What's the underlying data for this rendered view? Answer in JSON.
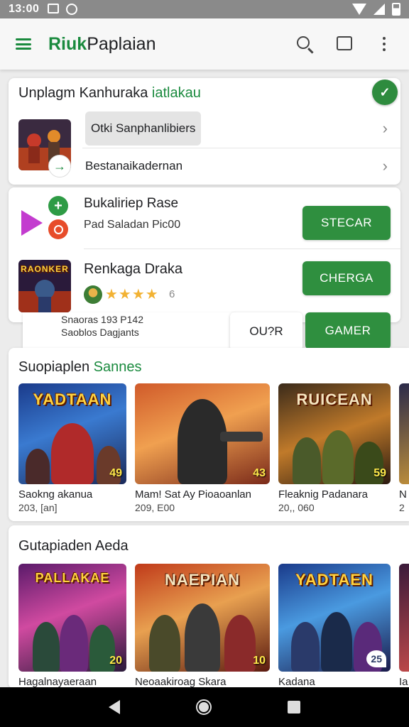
{
  "status_bar": {
    "time": "13:00"
  },
  "app_bar": {
    "title_part1": "Riuk",
    "title_part2": "Paplaian"
  },
  "card1": {
    "title_part1": "Unplagm Kanhuraka ",
    "title_part2": "iatlakau",
    "row1_label": "Otki Sanphanlibiers",
    "row2_label": "Bestanaikadernan"
  },
  "card2": {
    "title1": "Bukaliriep Rase",
    "sub1": "Pad Saladan Pic00",
    "title2": "Renkaga Draka",
    "stars": "★★★★",
    "rating_count": "6",
    "button1": "STECAR",
    "button2": "CHERGA",
    "mini_line1": "Snaoras 193 P142",
    "mini_line2": "Saoblos Dagjants",
    "button_outline": "OU?R",
    "button3": "GAMER",
    "thumb_text": "RAONKER"
  },
  "section1": {
    "title_part1": "Suopiaplen ",
    "title_part2": "Sannes",
    "tiles": [
      {
        "name": "Saokng akanua",
        "meta": "203, [an]",
        "art": "YADTAAN",
        "badge": "49"
      },
      {
        "name": "Mam! Sat Ay Pioaoanlan",
        "meta": "209, E00",
        "art": "",
        "badge": "43"
      },
      {
        "name": "Fleaknig Padanara",
        "meta": "20,, 060",
        "art": "RUICEAN",
        "badge": "59"
      },
      {
        "name": "N",
        "meta": "2",
        "art": "",
        "badge": ""
      }
    ]
  },
  "section2": {
    "title": "Gutapiaden Aeda",
    "tiles": [
      {
        "name": "Hagalnayaeraan",
        "art": "PALLAKAE",
        "badge": "20"
      },
      {
        "name": "Neoaakiroag Skara",
        "art": "NAEPIAN",
        "badge": "10"
      },
      {
        "name": "Kadana",
        "art": "YADTAEN",
        "badge": "25"
      },
      {
        "name": "Ia",
        "art": "",
        "badge": ""
      }
    ]
  },
  "colors": {
    "accent": "#2f8f3f",
    "brand": "#1a8a3e",
    "star": "#f2b233"
  }
}
